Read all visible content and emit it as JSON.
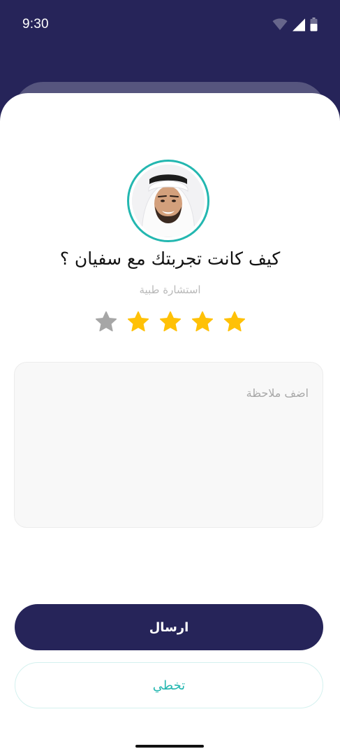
{
  "status_bar": {
    "time": "9:30",
    "icons": [
      "wifi-icon",
      "cellular-signal-icon",
      "battery-icon"
    ]
  },
  "rating": {
    "question": "كيف كانت تجربتك مع سفيان ؟",
    "service_type": "استشارة طبية",
    "stars_filled": 4,
    "stars_total": 5,
    "note_placeholder": "اضف ملاحظة",
    "note_value": ""
  },
  "actions": {
    "submit_label": "ارسال",
    "skip_label": "تخطي"
  },
  "colors": {
    "primary": "#262459",
    "accent": "#23b7b0",
    "star_filled": "#ffc107",
    "star_empty": "#a6a6a6"
  }
}
